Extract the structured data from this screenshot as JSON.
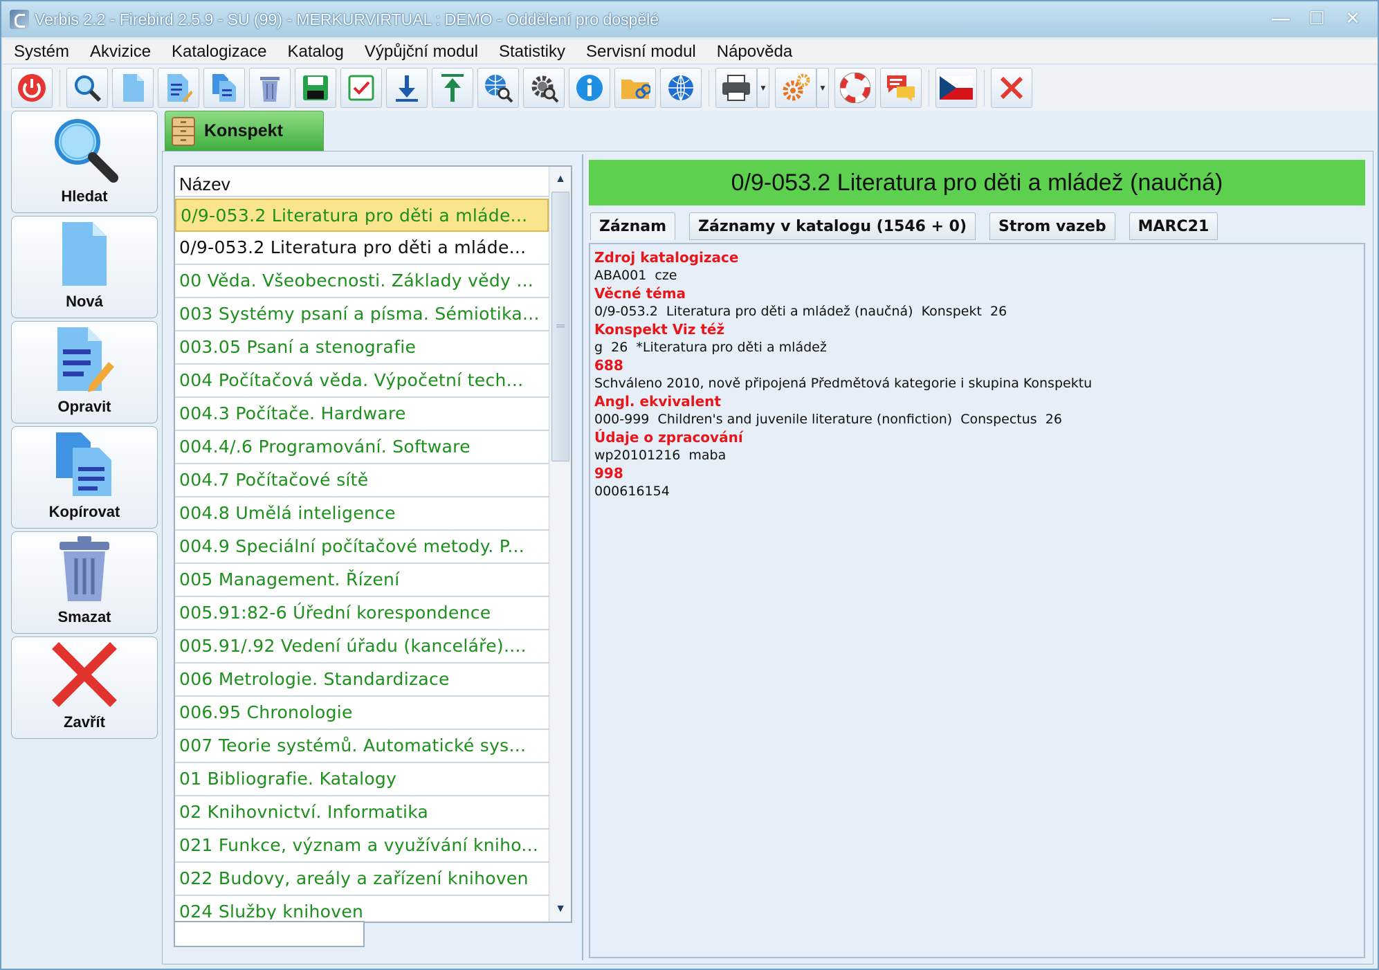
{
  "window": {
    "title": "Verbis 2.2 - Firebird 2.5.9 - SU (99) - MERKURVIRTUAL : DEMO - Oddělení pro dospělé",
    "controls": [
      "—",
      "☐",
      "✕"
    ]
  },
  "menu": [
    "Systém",
    "Akvizice",
    "Katalogizace",
    "Katalog",
    "Výpůjční modul",
    "Statistiky",
    "Servisní modul",
    "Nápověda"
  ],
  "toolbar": {
    "icons": [
      "power-icon",
      "search-icon",
      "new-document-icon",
      "edit-document-icon",
      "copy-document-icon",
      "trash-icon",
      "save-icon",
      "checkmark-icon",
      "download-icon",
      "upload-icon",
      "globe-search-icon",
      "gear-search-icon",
      "info-icon",
      "folder-link-icon",
      "globe-icon",
      "printer-icon",
      "settings-icon",
      "lifebuoy-icon",
      "chat-icon",
      "czech-flag-icon",
      "close-icon"
    ]
  },
  "sidebar": {
    "buttons": [
      {
        "label": "Hledat",
        "icon": "magnifier-icon"
      },
      {
        "label": "Nová",
        "icon": "new-document-icon"
      },
      {
        "label": "Opravit",
        "icon": "edit-document-icon"
      },
      {
        "label": "Kopírovat",
        "icon": "copy-document-icon"
      },
      {
        "label": "Smazat",
        "icon": "trash-icon"
      },
      {
        "label": "Zavřít",
        "icon": "close-icon"
      }
    ]
  },
  "tab": {
    "label": "Konspekt",
    "icon": "cabinet-icon"
  },
  "list": {
    "header": "Název",
    "rows": [
      "0/9-053.2 Literatura pro děti a mláde...",
      "0/9-053.2 Literatura pro děti a mláde...",
      "00 Věda. Všeobecnosti. Základy vědy ...",
      "003 Systémy psaní a písma. Sémiotika...",
      "003.05 Psaní a stenografie",
      "004 Počítačová věda. Výpočetní tech...",
      "004.3 Počítače. Hardware",
      "004.4/.6 Programování. Software",
      "004.7 Počítačové sítě",
      "004.8 Umělá inteligence",
      "004.9 Speciální počítačové metody. P...",
      "005 Management. Řízení",
      "005.91:82-6 Úřední korespondence",
      "005.91/.92 Vedení úřadu (kanceláře)....",
      "006 Metrologie. Standardizace",
      "006.95 Chronologie",
      "007 Teorie systémů. Automatické sys...",
      "01 Bibliografie. Katalogy",
      "02 Knihovnictví. Informatika",
      "021 Funkce, význam a využívání kniho...",
      "022 Budovy, areály a zařízení knihoven",
      "024 Služby knihoven"
    ],
    "search_value": ""
  },
  "detail": {
    "title": "0/9-053.2 Literatura pro děti a mládež (naučná)",
    "tabs": [
      "Záznam",
      "Záznamy v katalogu (1546 + 0)",
      "Strom vazeb",
      "MARC21"
    ],
    "fields": [
      {
        "label": "Zdroj katalogizace",
        "value": "ABA001  cze"
      },
      {
        "label": "Věcné téma",
        "value": "0/9-053.2  Literatura pro děti a mládež (naučná)  Konspekt  26"
      },
      {
        "label": "Konspekt Viz též",
        "value": "g  26  *Literatura pro děti a mládež"
      },
      {
        "label": "688",
        "value": "Schváleno 2010, nově připojená Předmětová kategorie i skupina Konspektu"
      },
      {
        "label": "Angl. ekvivalent",
        "value": "000-999  Children's and juvenile literature (nonfiction)  Conspectus  26"
      },
      {
        "label": "Údaje o zpracování",
        "value": "wp20101216  maba"
      },
      {
        "label": "998",
        "value": "000616154"
      }
    ]
  },
  "colors": {
    "selected_row": "#fbe48e",
    "list_text": "#1d8f1d",
    "title_bar": "#5dd14f",
    "field_label": "#e8161b"
  }
}
